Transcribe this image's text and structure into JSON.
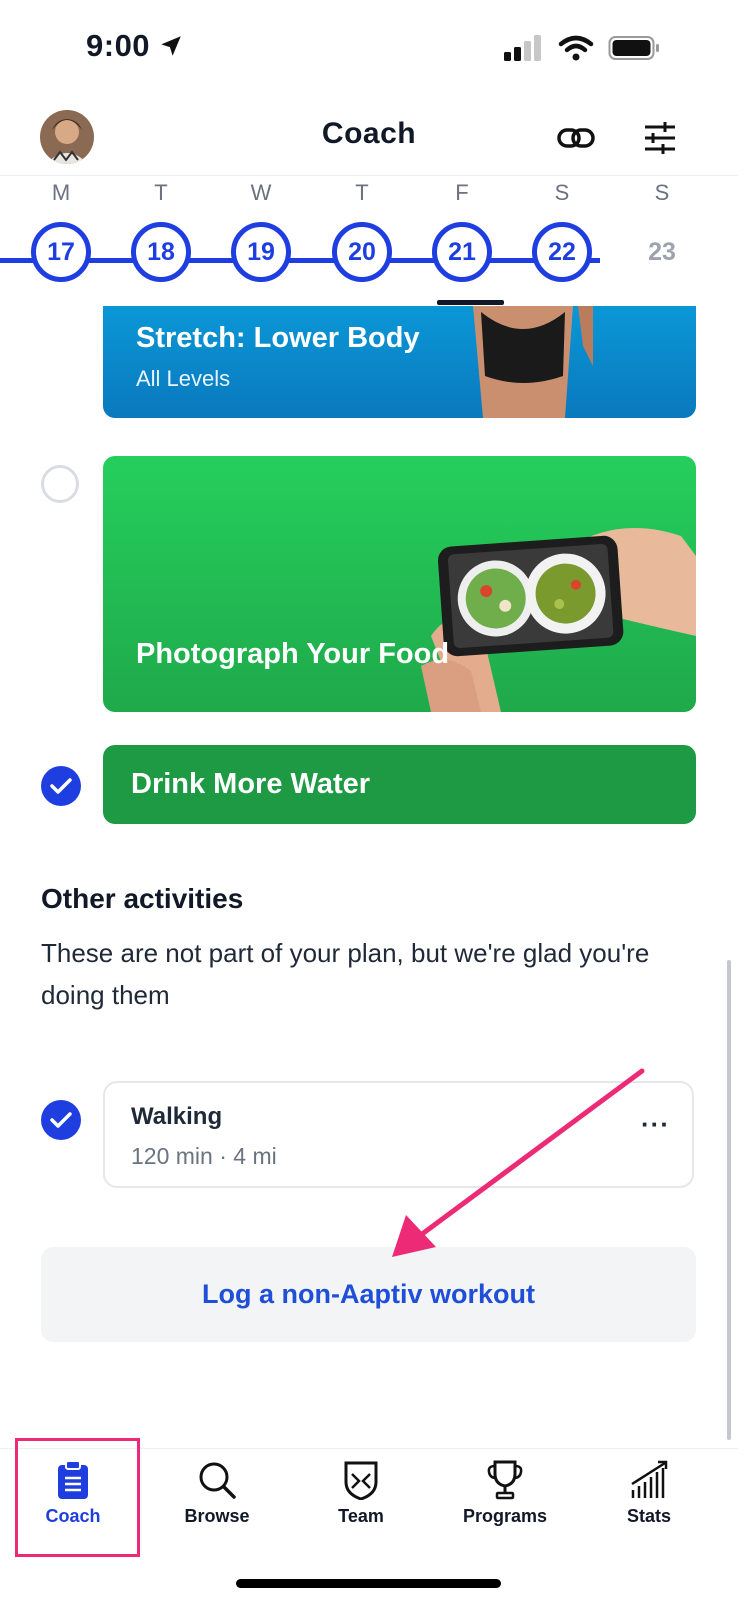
{
  "status_bar": {
    "time": "9:00"
  },
  "header": {
    "title": "Coach"
  },
  "week": {
    "letters": [
      "M",
      "T",
      "W",
      "T",
      "F",
      "S",
      "S"
    ],
    "dates": [
      "17",
      "18",
      "19",
      "20",
      "21",
      "22",
      "23"
    ]
  },
  "plan_cards": {
    "stretch": {
      "title": "Stretch: Lower Body",
      "subtitle": "All Levels"
    },
    "photograph": {
      "title": "Photograph Your Food"
    },
    "water": {
      "title": "Drink More Water"
    }
  },
  "other_activities": {
    "title": "Other activities",
    "description": "These are not part of your plan, but we're glad you're doing them",
    "items": [
      {
        "name": "Walking",
        "meta": "120 min · 4 mi",
        "more": "···"
      }
    ],
    "log_button": "Log a non-Aaptiv workout"
  },
  "tabs": [
    {
      "label": "Coach",
      "icon": "clipboard-icon"
    },
    {
      "label": "Browse",
      "icon": "search-icon"
    },
    {
      "label": "Team",
      "icon": "shield-icon"
    },
    {
      "label": "Programs",
      "icon": "trophy-icon"
    },
    {
      "label": "Stats",
      "icon": "bar-chart-icon"
    }
  ],
  "colors": {
    "accent": "#1f3ee0",
    "highlight": "#ec2a75",
    "green": "#1e9a44"
  }
}
